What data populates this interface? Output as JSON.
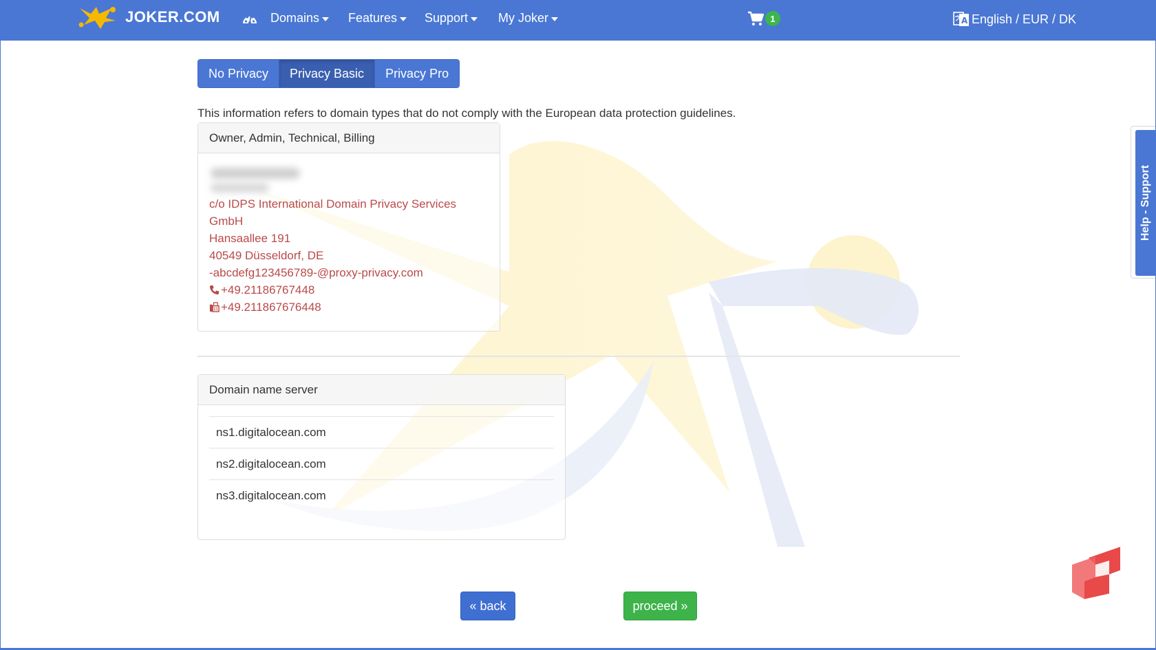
{
  "brand": {
    "name": "JOKER.COM",
    "logo_icon": "jester-star-icon"
  },
  "nav": {
    "dashboard_icon": "dashboard-gauge-icon",
    "items": [
      {
        "label": "Domains"
      },
      {
        "label": "Features"
      },
      {
        "label": "Support"
      },
      {
        "label": "My Joker"
      }
    ],
    "cart_count": "1",
    "language_label": "English / EUR / DK"
  },
  "privacy_tabs": {
    "items": [
      {
        "label": "No Privacy"
      },
      {
        "label": "Privacy Basic",
        "active": true
      },
      {
        "label": "Privacy Pro"
      }
    ]
  },
  "info_text": "This information refers to domain types that do not comply with the European data protection guidelines.",
  "contact_panel": {
    "heading": "Owner, Admin, Technical, Billing",
    "lines": [
      "c/o IDPS International Domain Privacy Services",
      "GmbH",
      "Hansaallee 191",
      "40549 Düsseldorf, DE",
      "-abcdefg123456789-@proxy-privacy.com"
    ],
    "phone": "+49.21186767448",
    "fax": "+49.211867676448"
  },
  "ns_panel": {
    "heading": "Domain name server",
    "servers": [
      "ns1.digitalocean.com",
      "ns2.digitalocean.com",
      "ns3.digitalocean.com"
    ]
  },
  "buttons": {
    "back": "« back",
    "proceed": "proceed »"
  },
  "help_tab": {
    "label": "Help - Support"
  },
  "colors": {
    "nav": "#4a77d4",
    "link_red": "#b94a48",
    "proceed_green": "#3db34a",
    "badge_green": "#3cb54a"
  }
}
